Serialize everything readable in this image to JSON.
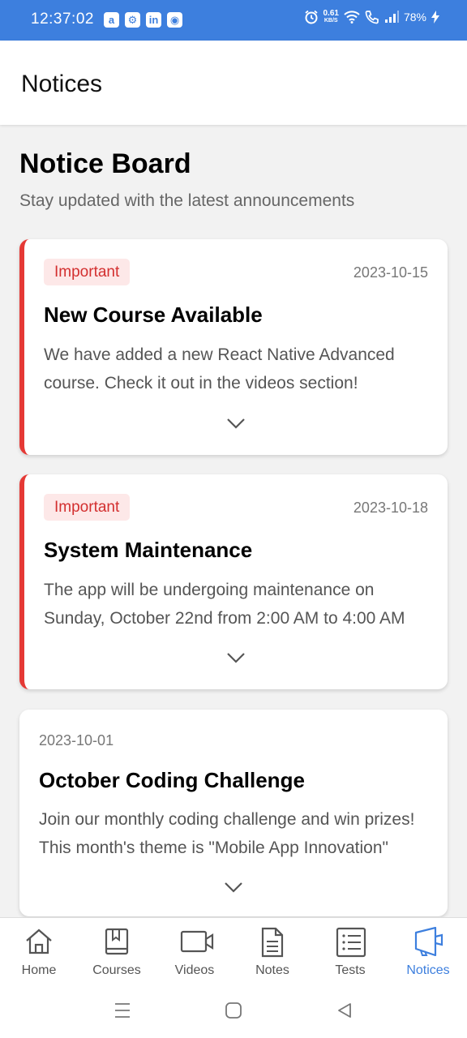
{
  "status_bar": {
    "time": "12:37:02",
    "apps": [
      "a",
      "⚙",
      "in",
      "◉"
    ],
    "speed_value": "0.61",
    "speed_unit": "KB/S",
    "battery": "78%"
  },
  "header": {
    "title": "Notices"
  },
  "board": {
    "title": "Notice Board",
    "subtitle": "Stay updated with the latest announcements"
  },
  "notices": [
    {
      "badge": "Important",
      "date": "2023-10-15",
      "title": "New Course Available",
      "body": "We have added a new React Native Advanced course. Check it out in the videos section!"
    },
    {
      "badge": "Important",
      "date": "2023-10-18",
      "title": "System Maintenance",
      "body": "The app will be undergoing maintenance on Sunday, October 22nd from 2:00 AM to 4:00 AM"
    },
    {
      "badge": "",
      "date": "2023-10-01",
      "title": "October Coding Challenge",
      "body": "Join our monthly coding challenge and win prizes! This month's theme is \"Mobile App Innovation\""
    }
  ],
  "tabs": [
    {
      "label": "Home",
      "icon": "home-icon"
    },
    {
      "label": "Courses",
      "icon": "book-icon"
    },
    {
      "label": "Videos",
      "icon": "video-icon"
    },
    {
      "label": "Notes",
      "icon": "document-icon"
    },
    {
      "label": "Tests",
      "icon": "list-icon"
    },
    {
      "label": "Notices",
      "icon": "megaphone-icon",
      "active": true
    }
  ],
  "colors": {
    "accent": "#3d7fde",
    "important": "#e53935",
    "badge_bg": "#fde8e8"
  }
}
